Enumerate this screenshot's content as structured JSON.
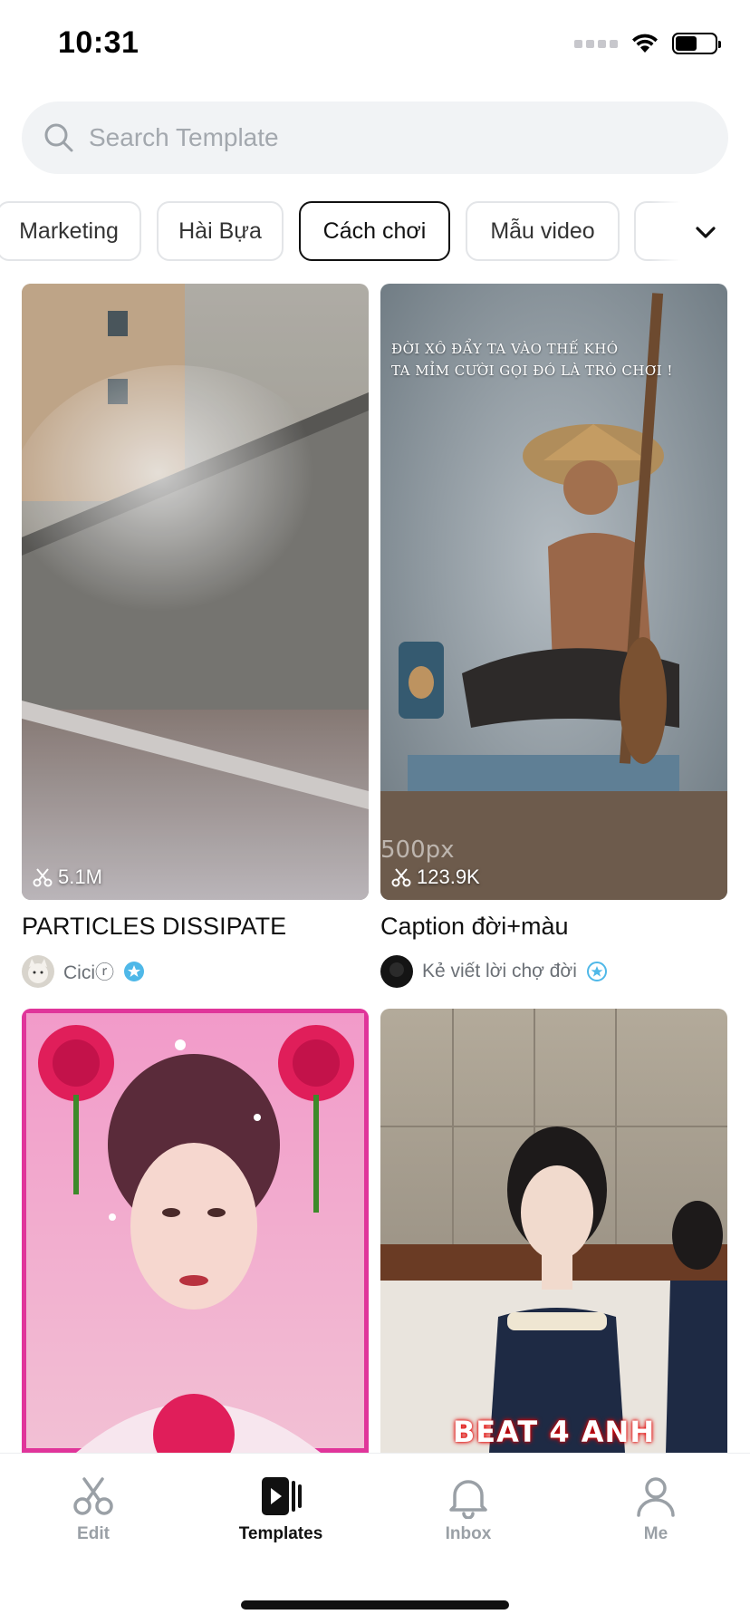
{
  "status_bar": {
    "time": "10:31"
  },
  "search": {
    "placeholder": "Search Template"
  },
  "categories": [
    {
      "label": "Marketing",
      "active": false
    },
    {
      "label": "Hài Bựa",
      "active": false
    },
    {
      "label": "Cách chơi",
      "active": true
    },
    {
      "label": "Mẫu video",
      "active": false
    }
  ],
  "templates": [
    {
      "title": "PARTICLES DISSIPATE",
      "uses": "5.1M",
      "author": "Ciciⓡ",
      "verified": true
    },
    {
      "title": "Caption đời+màu",
      "uses": "123.9K",
      "author": "Kẻ viết lời chợ đời",
      "verified": true,
      "overlay_line1": "ĐỜI XÔ ĐẨY TA VÀO THẾ KHÓ",
      "overlay_line2": "TA MỈM CƯỜI GỌI ĐÓ LÀ TRÒ CHƠI !",
      "watermark": "500px"
    },
    {
      "title": "",
      "uses": ""
    },
    {
      "title": "",
      "uses": "",
      "overlay_text": "BEAT 4 ANH"
    }
  ],
  "tabs": [
    {
      "label": "Edit",
      "icon": "scissors-icon",
      "active": false
    },
    {
      "label": "Templates",
      "icon": "templates-icon",
      "active": true
    },
    {
      "label": "Inbox",
      "icon": "bell-icon",
      "active": false
    },
    {
      "label": "Me",
      "icon": "person-icon",
      "active": false
    }
  ],
  "colors": {
    "accent": "#111111",
    "verified": "#4fb8e8",
    "tab_inactive": "#9aa0a6"
  }
}
